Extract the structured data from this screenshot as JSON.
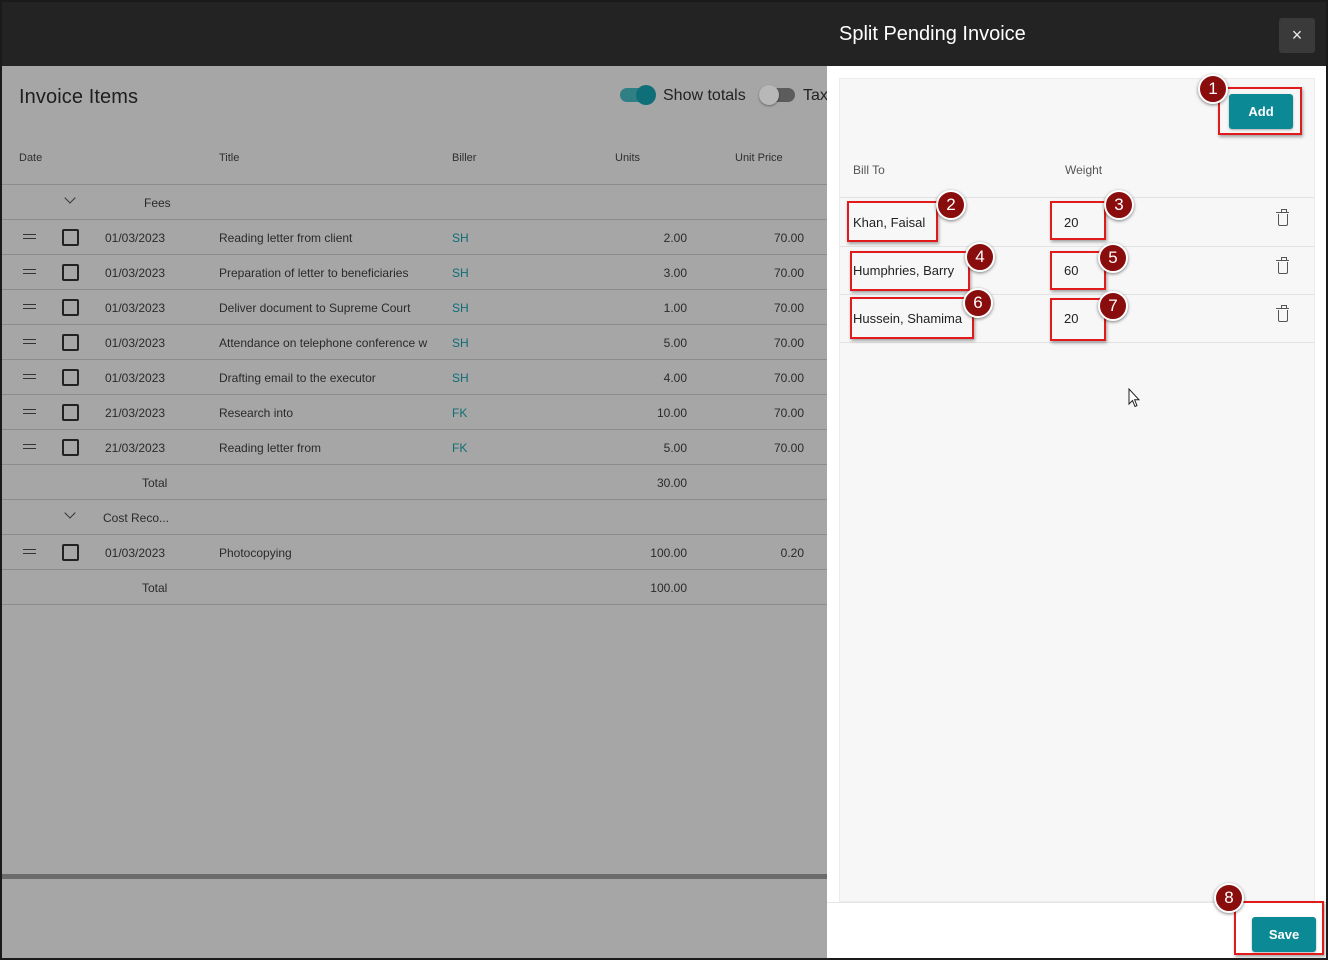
{
  "app": {
    "title": "Invoice Items",
    "toggles": [
      {
        "label": "Show totals",
        "on": true
      },
      {
        "label": "Tax",
        "on": false
      }
    ],
    "columns": [
      "Date",
      "Title",
      "Biller",
      "Units",
      "Unit Price"
    ],
    "groups": [
      {
        "name": "Fees",
        "rows": [
          {
            "date": "01/03/2023",
            "title": "Reading letter from client",
            "biller": "SH",
            "units": "2.00",
            "unit_price": "70.00"
          },
          {
            "date": "01/03/2023",
            "title": "Preparation of letter to beneficiaries",
            "biller": "SH",
            "units": "3.00",
            "unit_price": "70.00"
          },
          {
            "date": "01/03/2023",
            "title": "Deliver document to Supreme Court",
            "biller": "SH",
            "units": "1.00",
            "unit_price": "70.00"
          },
          {
            "date": "01/03/2023",
            "title": "Attendance on telephone conference w",
            "biller": "SH",
            "units": "5.00",
            "unit_price": "70.00"
          },
          {
            "date": "01/03/2023",
            "title": "Drafting email to the executor",
            "biller": "SH",
            "units": "4.00",
            "unit_price": "70.00"
          },
          {
            "date": "21/03/2023",
            "title": "Research into",
            "biller": "FK",
            "units": "10.00",
            "unit_price": "70.00"
          },
          {
            "date": "21/03/2023",
            "title": "Reading letter from",
            "biller": "FK",
            "units": "5.00",
            "unit_price": "70.00"
          }
        ],
        "total_label": "Total",
        "total_units": "30.00"
      },
      {
        "name": "Cost Reco...",
        "rows": [
          {
            "date": "01/03/2023",
            "title": "Photocopying",
            "biller": "",
            "units": "100.00",
            "unit_price": "0.20"
          }
        ],
        "total_label": "Total",
        "total_units": "100.00"
      }
    ]
  },
  "drawer": {
    "title": "Split Pending Invoice",
    "close_icon": "×",
    "add_label": "Add",
    "columns": {
      "bill_to": "Bill To",
      "weight": "Weight"
    },
    "splits": [
      {
        "bill_to": "Khan, Faisal",
        "weight": "20"
      },
      {
        "bill_to": "Humphries, Barry",
        "weight": "60"
      },
      {
        "bill_to": "Hussein, Shamima",
        "weight": "20"
      }
    ],
    "save_label": "Save"
  },
  "callouts": [
    "1",
    "2",
    "3",
    "4",
    "5",
    "6",
    "7",
    "8"
  ],
  "colors": {
    "accent": "#0b8a96",
    "callout": "#8a0d0d",
    "highlight": "#e11b1b",
    "header": "#232323"
  }
}
